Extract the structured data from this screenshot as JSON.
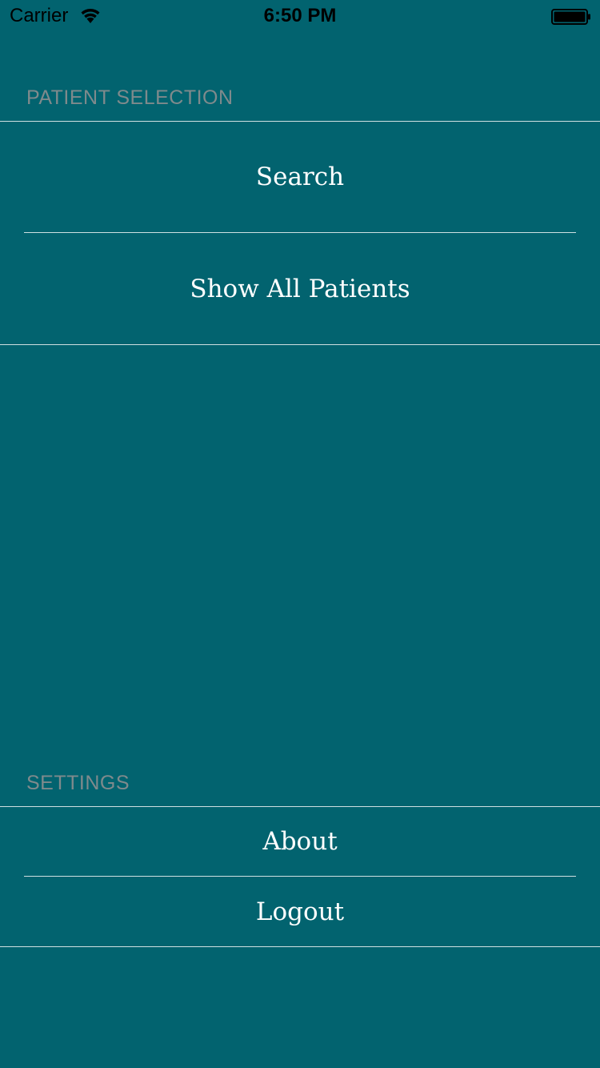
{
  "status_bar": {
    "carrier": "Carrier",
    "time": "6:50 PM",
    "wifi_icon": "wifi-icon",
    "battery_icon": "battery-icon"
  },
  "sections": {
    "patient_selection": {
      "header": "PATIENT SELECTION",
      "items": [
        {
          "label": "Search"
        },
        {
          "label": "Show All Patients"
        }
      ]
    },
    "settings": {
      "header": "SETTINGS",
      "items": [
        {
          "label": "About"
        },
        {
          "label": "Logout"
        }
      ]
    }
  },
  "colors": {
    "background": "#02636f",
    "header_text": "#7f8a8c",
    "cell_text": "#ffffff",
    "separator": "#cfe0e2"
  }
}
